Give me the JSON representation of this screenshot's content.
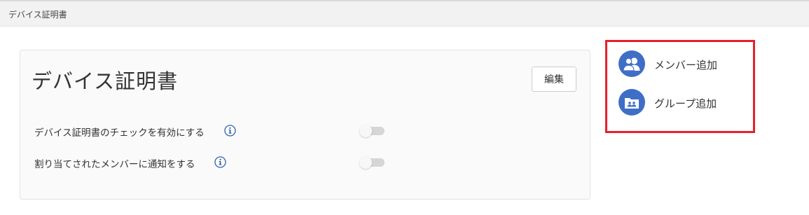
{
  "header": {
    "title": "デバイス証明書"
  },
  "card": {
    "title": "デバイス証明書",
    "edit_label": "編集",
    "settings": [
      {
        "label": "デバイス証明書のチェックを有効にする",
        "enabled": false
      },
      {
        "label": "割り当てされたメンバーに通知をする",
        "enabled": false
      }
    ]
  },
  "actions": {
    "items": [
      {
        "label": "メンバー追加",
        "icon": "users-icon"
      },
      {
        "label": "グループ追加",
        "icon": "group-folder-icon"
      }
    ]
  },
  "colors": {
    "accent": "#3f6ec6",
    "highlight_border": "#e8202a",
    "info": "#2e5fa8"
  }
}
